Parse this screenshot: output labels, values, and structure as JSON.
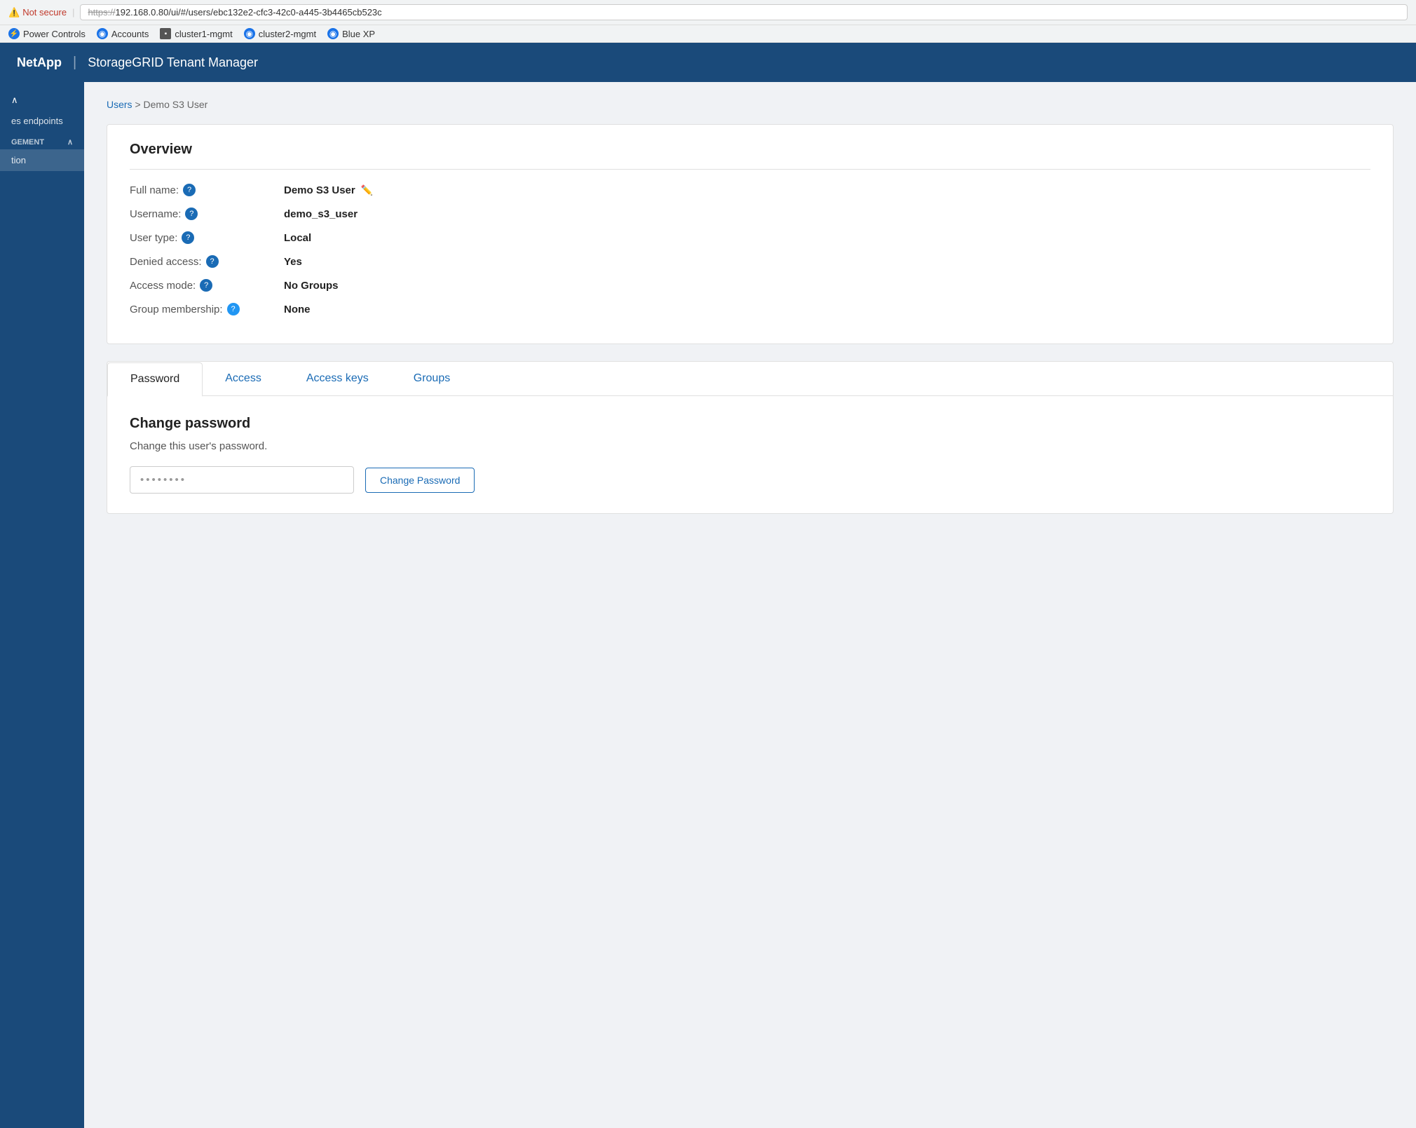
{
  "browser": {
    "not_secure_label": "Not secure",
    "url_prefix": "https://",
    "url_strikethrough": "https://",
    "url": "192.168.0.80/ui/#/users/ebc132e2-cfc3-42c0-a445-3b4465cb523c",
    "url_display": "https://192.168.0.80/ui/#/users/ebc132e2-cfc3-42c0-a445-3b4465cb523c"
  },
  "bookmarks": [
    {
      "label": "Power Controls",
      "icon_type": "circle",
      "icon_char": "⚡"
    },
    {
      "label": "Accounts",
      "icon_type": "circle",
      "icon_char": "◎"
    },
    {
      "label": "cluster1-mgmt",
      "icon_type": "square",
      "icon_char": "■"
    },
    {
      "label": "cluster2-mgmt",
      "icon_type": "circle",
      "icon_char": "◎"
    },
    {
      "label": "Blue XP",
      "icon_type": "circle",
      "icon_char": "◎"
    }
  ],
  "header": {
    "brand": "NetApp",
    "divider": "|",
    "app_title": "StorageGRID Tenant Manager"
  },
  "sidebar": {
    "toggle_label": "^",
    "endpoints_label": "es endpoints",
    "management_label": "GEMENT",
    "management_toggle": "^",
    "active_item": "tion",
    "items": []
  },
  "breadcrumb": {
    "parent": "Users",
    "separator": ">",
    "current": "Demo S3 User"
  },
  "overview": {
    "title": "Overview",
    "fields": [
      {
        "label": "Full name:",
        "value": "Demo S3 User",
        "has_help": true,
        "has_edit": true
      },
      {
        "label": "Username:",
        "value": "demo_s3_user",
        "has_help": true,
        "has_edit": false
      },
      {
        "label": "User type:",
        "value": "Local",
        "has_help": true,
        "has_edit": false
      },
      {
        "label": "Denied access:",
        "value": "Yes",
        "has_help": true,
        "has_edit": false
      },
      {
        "label": "Access mode:",
        "value": "No Groups",
        "has_help": true,
        "has_edit": false
      },
      {
        "label": "Group membership:",
        "value": "None",
        "has_help": true,
        "has_edit": false
      }
    ]
  },
  "tabs": [
    {
      "label": "Password",
      "active": true
    },
    {
      "label": "Access",
      "active": false
    },
    {
      "label": "Access keys",
      "active": false
    },
    {
      "label": "Groups",
      "active": false
    }
  ],
  "password_tab": {
    "title": "Change password",
    "description": "Change this user's password.",
    "input_placeholder": "••••••••",
    "button_label": "Change Password"
  }
}
